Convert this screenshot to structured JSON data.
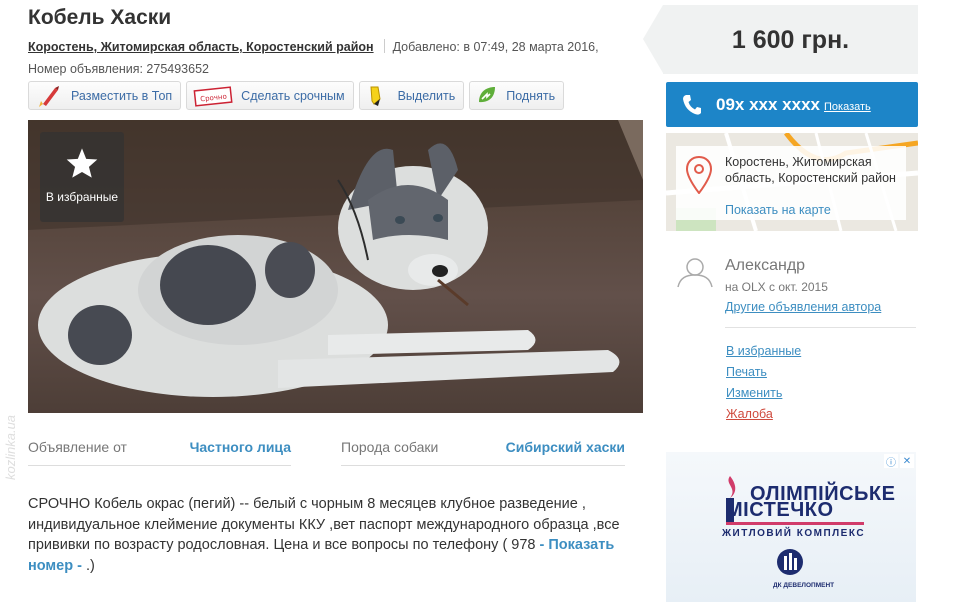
{
  "listing": {
    "title": "Кобель Хаски",
    "location": "Коростень, Житомирская область, Коростенский район",
    "added": "Добавлено: в 07:49, 28 марта 2016,",
    "ad_number": "Номер объявления: 275493652"
  },
  "toolbar": {
    "top": "Разместить в Топ",
    "urgent": "Сделать срочным",
    "urgent_stamp": "Срочно",
    "highlight": "Выделить",
    "raise": "Поднять"
  },
  "photo": {
    "favorite_label": "В избранные"
  },
  "params": [
    {
      "key": "Объявление от",
      "value": "Частного лица"
    },
    {
      "key": "Порода собаки",
      "value": "Сибирский хаски"
    }
  ],
  "description": {
    "text": "СРОЧНО Кобель окрас (пегий) -- белый с чорным 8 месяцев клубное разведение , индивидуальное клеймение документы ККУ ,вет паспорт международного образца ,все прививки по возрасту родословная. Цена и все вопросы по телефону ( 978",
    "show_link": "- Показать номер -",
    "tail": ".)"
  },
  "sidebar": {
    "price": "1 600 грн.",
    "phone": "09x xxx xxxx",
    "phone_show": "Показать",
    "map_address": "Коростень, Житомирская область, Коростенский район",
    "map_link": "Показать на карте",
    "user_name": "Александр",
    "user_since": "на OLX с окт. 2015",
    "user_other": "Другие объявления автора",
    "actions": [
      "В избранные",
      "Печать",
      "Изменить",
      "Жалоба"
    ]
  },
  "ad_banner": {
    "line1": "ОЛІМПІЙСЬКЕ",
    "line2": "МІСТЕЧКО",
    "line3": "ЖИТЛОВИЙ КОМПЛЕКС",
    "developer": "ДК ДЕВЕЛОПМЕНТ"
  },
  "watermark": "kozlinka.ua",
  "colors": {
    "accent": "#1d85c8",
    "link": "#3d8ec1",
    "complaint": "#cf4a3d",
    "price_bg": "#f0f2f2"
  }
}
